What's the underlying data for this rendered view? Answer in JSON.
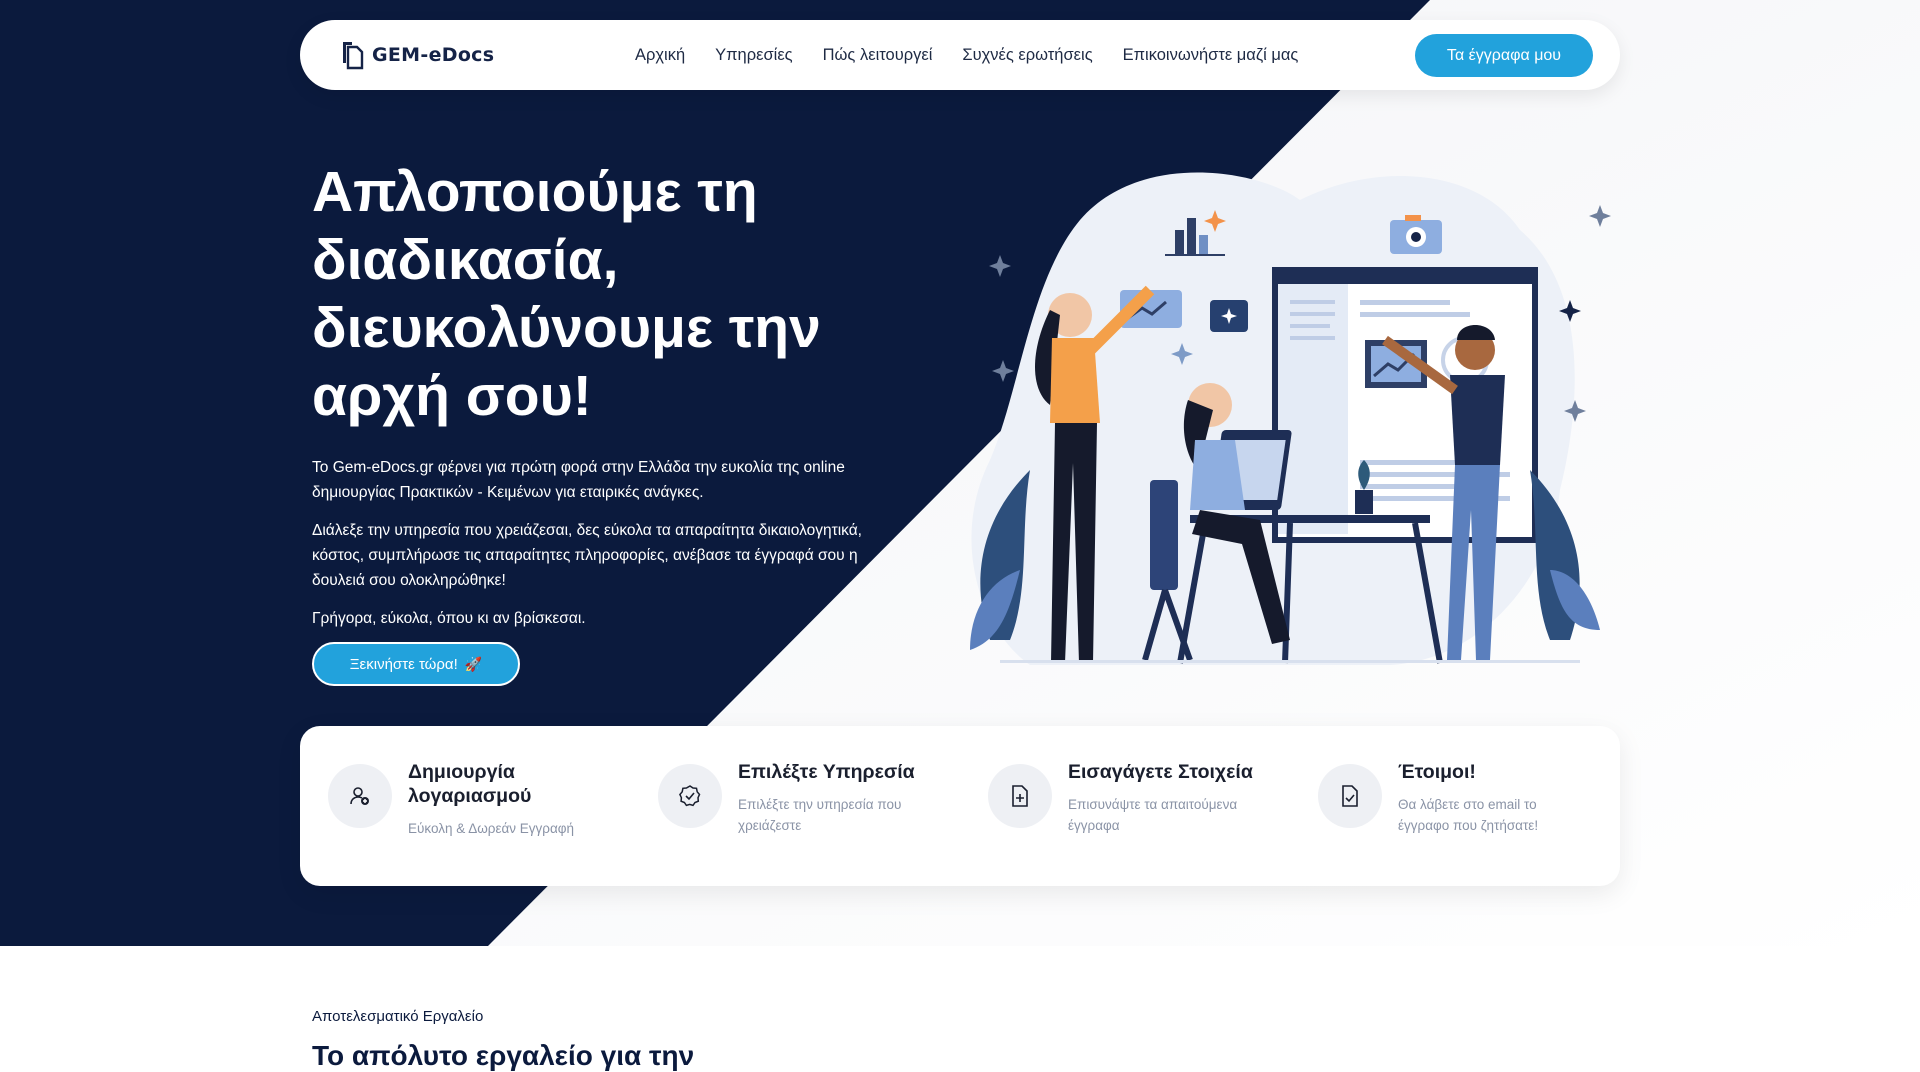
{
  "brand": {
    "name": "GEM-eDocs"
  },
  "nav": {
    "items": [
      {
        "label": "Αρχική"
      },
      {
        "label": "Υπηρεσίες"
      },
      {
        "label": "Πώς λειτουργεί"
      },
      {
        "label": "Συχνές ερωτήσεις"
      },
      {
        "label": "Επικοινωνήστε μαζί μας"
      }
    ],
    "cta": "Τα έγγραφα μου"
  },
  "hero": {
    "title": "Απλοποιούμε τη διαδικασία, διευκολύνουμε την αρχή σου!",
    "paragraphs": [
      "Το Gem-eDocs.gr φέρνει για πρώτη φορά στην Ελλάδα την ευκολία της online δημιουργίας Πρακτικών - Κειμένων για εταιρικές ανάγκες.",
      "Διάλεξε την υπηρεσία που χρειάζεσαι, δες εύκολα τα απαραίτητα δικαιολογητικά, κόστος, συμπλήρωσε τις απαραίτητες πληροφορίες, ανέβασε τα έγγραφά σου η δουλειά σου ολοκληρώθηκε!",
      "Γρήγορα, εύκολα, όπου κι αν βρίσκεσαι."
    ],
    "cta": "Ξεκινήστε τώρα!"
  },
  "steps": [
    {
      "title": "Δημιουργία λογαριασμού",
      "subtitle": "Εύκολη & Δωρεάν Εγγραφή",
      "icon": "user-add-icon"
    },
    {
      "title": "Επιλέξτε Υπηρεσία",
      "subtitle": "Επιλέξτε την υπηρεσία που χρειάζεστε",
      "icon": "badge-check-icon"
    },
    {
      "title": "Εισαγάγετε Στοιχεία",
      "subtitle": "Επισυνάψτε τα απαιτούμενα έγγραφα",
      "icon": "document-add-icon"
    },
    {
      "title": "Έτοιμοι!",
      "subtitle": "Θα λάβετε στο email το έγγραφο που ζητήσατε!",
      "icon": "document-check-icon"
    }
  ],
  "section": {
    "eyebrow": "Αποτελεσματικό Εργαλείο",
    "title": "Το απόλυτο εργαλείο για την"
  },
  "colors": {
    "navy": "#0b1a3d",
    "accent": "#22a2dc",
    "white": "#ffffff",
    "muted": "#8a93a6"
  }
}
